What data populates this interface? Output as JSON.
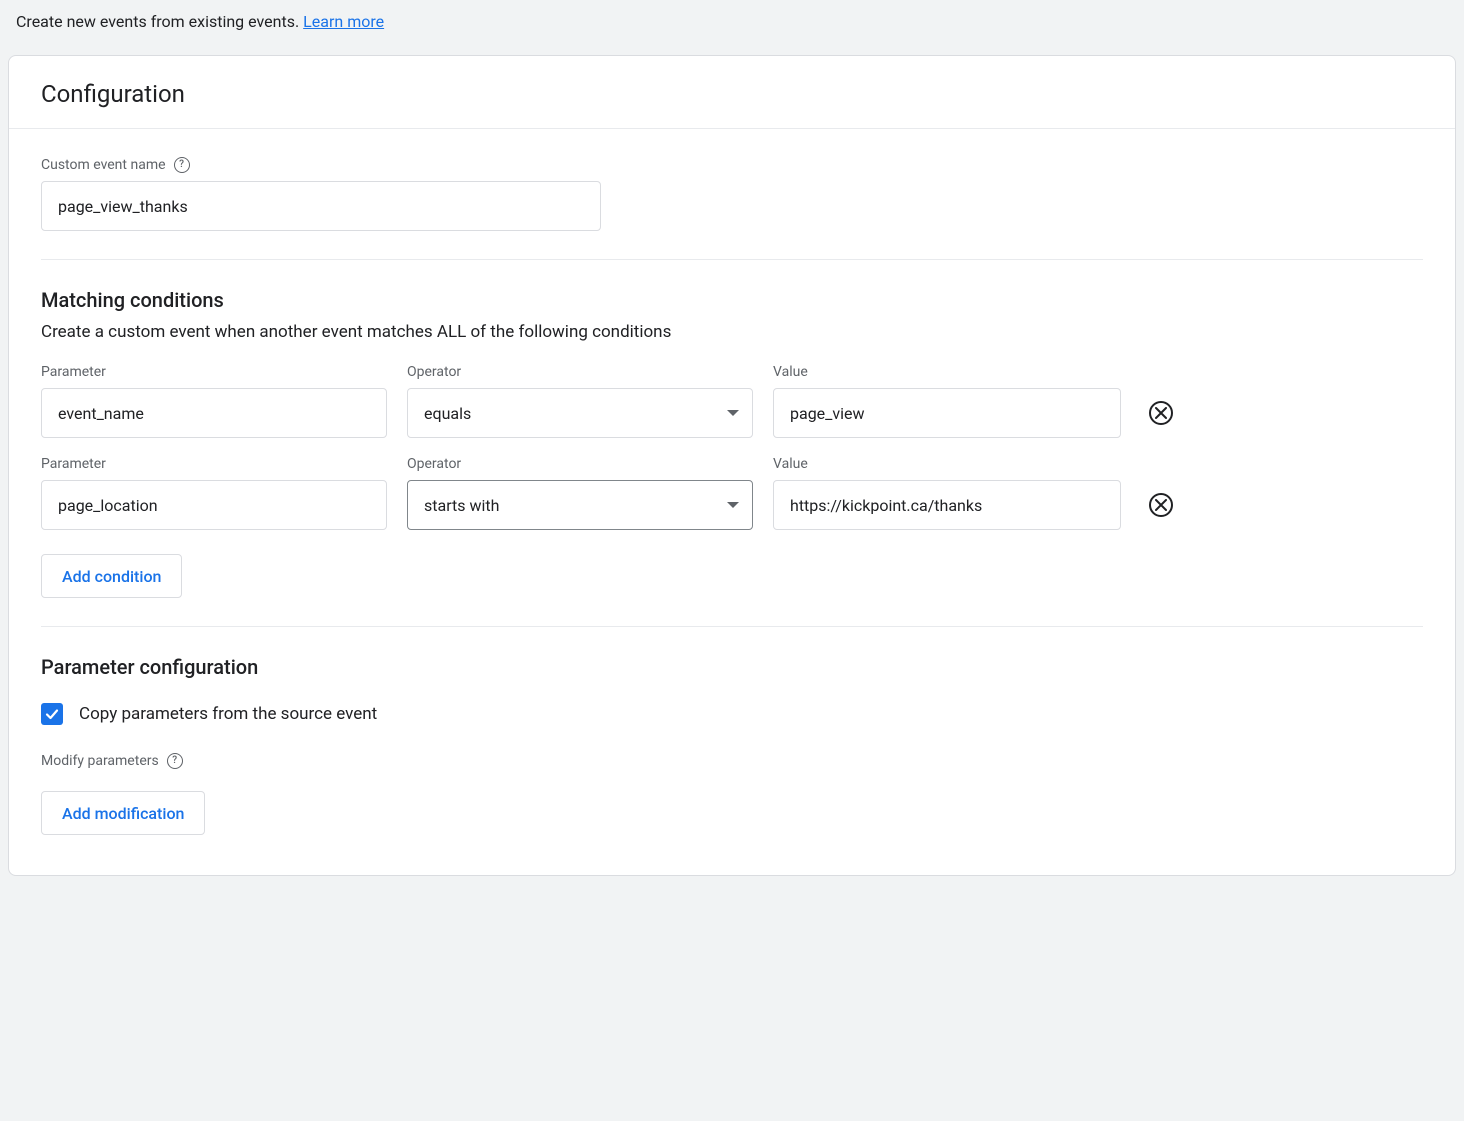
{
  "intro": {
    "text": "Create new events from existing events. ",
    "link": "Learn more"
  },
  "header": {
    "title": "Configuration"
  },
  "eventName": {
    "label": "Custom event name",
    "value": "page_view_thanks"
  },
  "matching": {
    "title": "Matching conditions",
    "desc": "Create a custom event when another event matches ALL of the following conditions",
    "labels": {
      "parameter": "Parameter",
      "operator": "Operator",
      "value": "Value"
    },
    "rows": [
      {
        "parameter": "event_name",
        "operator": "equals",
        "value": "page_view"
      },
      {
        "parameter": "page_location",
        "operator": "starts with",
        "value": "https://kickpoint.ca/thanks"
      }
    ],
    "addCondition": "Add condition"
  },
  "paramConfig": {
    "title": "Parameter configuration",
    "copyLabel": "Copy parameters from the source event",
    "modifyLabel": "Modify parameters",
    "addModification": "Add modification"
  }
}
